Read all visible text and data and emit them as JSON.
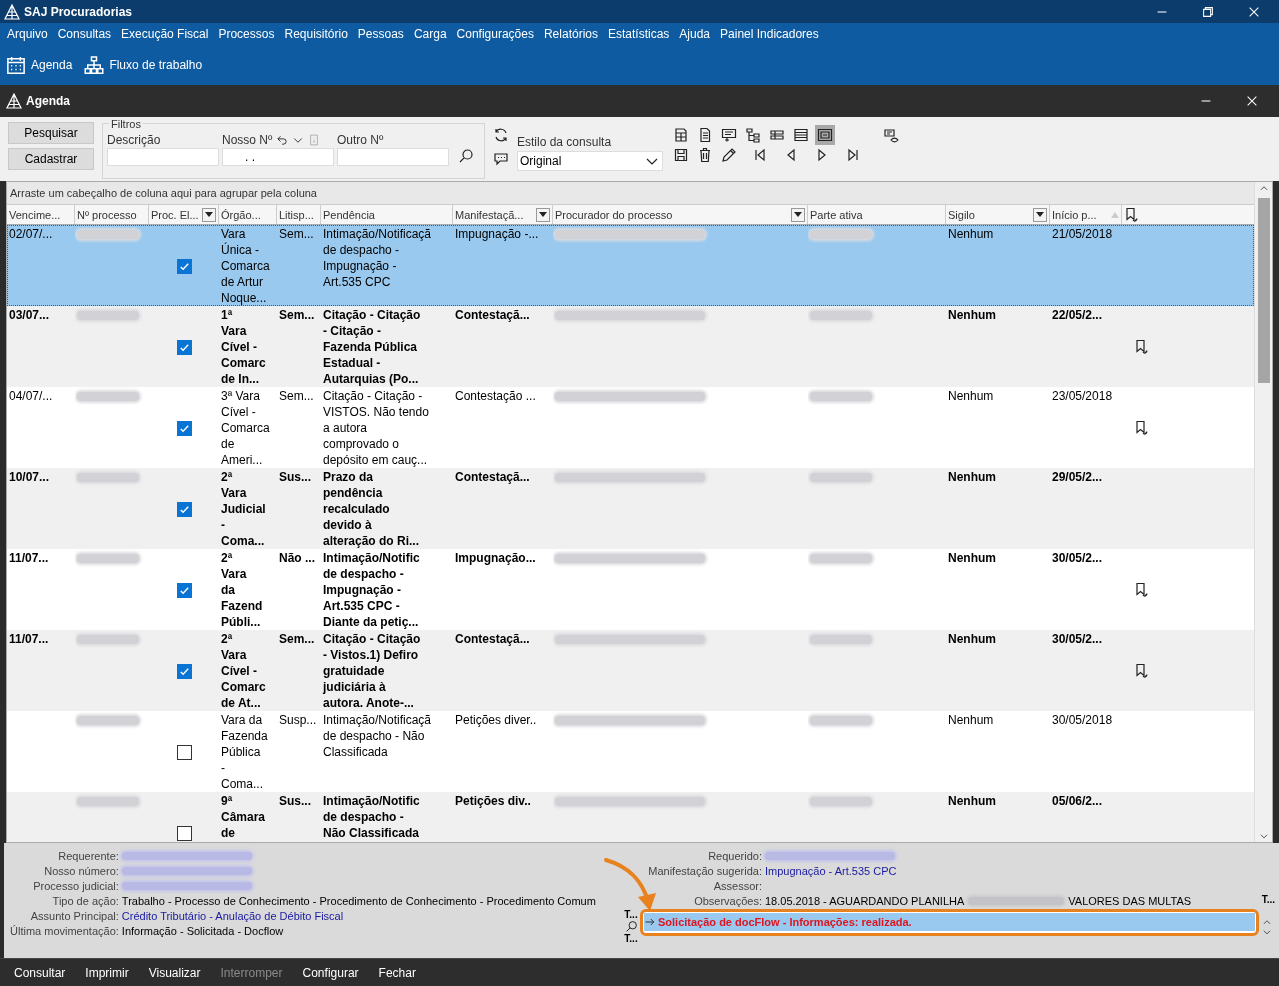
{
  "app": {
    "title": "SAJ Procuradorias"
  },
  "menu": [
    "Arquivo",
    "Consultas",
    "Execução Fiscal",
    "Processos",
    "Requisitório",
    "Pessoas",
    "Carga",
    "Configurações",
    "Relatórios",
    "Estatísticas",
    "Ajuda",
    "Painel Indicadores"
  ],
  "shortcuts": [
    {
      "label": "Agenda",
      "kind": "calendar"
    },
    {
      "label": "Fluxo de trabalho",
      "kind": "flowchart"
    }
  ],
  "window": {
    "title": "Agenda"
  },
  "actions": [
    "Pesquisar",
    "Cadastrar"
  ],
  "filters": {
    "title": "Filtros",
    "fields": [
      {
        "label": "Descrição",
        "kind": "text"
      },
      {
        "label": "Nosso Nº",
        "kind": "masked",
        "value": ". ."
      },
      {
        "label": "Outro Nº",
        "kind": "text"
      }
    ]
  },
  "query_style": {
    "label": "Estilo da consulta",
    "value": "Original"
  },
  "view_tools": [
    {
      "kind": "spreadsheet",
      "selected": false
    },
    {
      "kind": "document",
      "selected": false
    },
    {
      "kind": "form",
      "selected": false
    },
    {
      "kind": "tree",
      "selected": false
    },
    {
      "kind": "split",
      "selected": false
    },
    {
      "kind": "list",
      "selected": false
    },
    {
      "kind": "preview",
      "selected": true
    }
  ],
  "group_hint": "Arraste um cabeçalho de coluna aqui para agrupar pela coluna",
  "table": {
    "columns": [
      {
        "label": "Vencime...",
        "filter": false,
        "sorted": false
      },
      {
        "label": "Nº processo",
        "filter": false,
        "sorted": false
      },
      {
        "label": "Proc. El...",
        "filter": true,
        "sorted": false
      },
      {
        "label": "Órgão...",
        "filter": false,
        "sorted": false
      },
      {
        "label": "Litisp...",
        "filter": false,
        "sorted": false
      },
      {
        "label": "Pendência",
        "filter": false,
        "sorted": false
      },
      {
        "label": "Manifestaçã...",
        "filter": true,
        "sorted": false
      },
      {
        "label": "Procurador do processo",
        "filter": true,
        "sorted": false
      },
      {
        "label": "Parte ativa",
        "filter": false,
        "sorted": false
      },
      {
        "label": "Sigilo",
        "filter": true,
        "sorted": false
      },
      {
        "label": "Início p...",
        "filter": false,
        "sorted": true
      }
    ],
    "rows": [
      {
        "selected": true,
        "bold": false,
        "due": "02/07/...",
        "checked": true,
        "organ": "Vara\nÚnica -\nComarca\nde Artur\nNoque...",
        "litisp": "Sem...",
        "pending": "Intimação/Notificaçã\nde despacho -\nImpugnação -\nArt.535 CPC",
        "manifest": "Impugnação -...",
        "secrecy": "Nenhum",
        "start": "21/05/2018",
        "flagged": false
      },
      {
        "selected": false,
        "bold": true,
        "due": "03/07...",
        "checked": true,
        "organ": "1ª\nVara\nCível -\nComarc\nde In...",
        "litisp": "Sem...",
        "pending": "Citação - Citação\n- Citação -\nFazenda Pública\nEstadual -\nAutarquias (Po...",
        "manifest": "Contestaçã...",
        "secrecy": "Nenhum",
        "start": "22/05/2...",
        "flagged": true
      },
      {
        "selected": false,
        "bold": false,
        "due": "04/07/...",
        "checked": true,
        "organ": "3ª Vara\nCível -\nComarca\nde\nAmeri...",
        "litisp": "Sem...",
        "pending": "Citação - Citação -\nVISTOS. Não tendo\na autora\ncomprovado o\ndepósito em cauç...",
        "manifest": "Contestação ...",
        "secrecy": "Nenhum",
        "start": "23/05/2018",
        "flagged": true
      },
      {
        "selected": false,
        "bold": true,
        "due": "10/07...",
        "checked": true,
        "organ": "2ª\nVara\nJudicial\n-\nComa...",
        "litisp": "Sus...",
        "pending": "Prazo da\npendência\nrecalculado\ndevido à\nalteração do Ri...",
        "manifest": "Contestaçã...",
        "secrecy": "Nenhum",
        "start": "29/05/2...",
        "flagged": false
      },
      {
        "selected": false,
        "bold": true,
        "due": "11/07...",
        "checked": true,
        "organ": "2ª\nVara\nda\nFazend\nPúbli...",
        "litisp": "Não ...",
        "pending": "Intimação/Notific\nde despacho -\nImpugnação -\nArt.535 CPC -\nDiante da petiç...",
        "manifest": "Impugnação...",
        "secrecy": "Nenhum",
        "start": "30/05/2...",
        "flagged": true
      },
      {
        "selected": false,
        "bold": true,
        "due": "11/07...",
        "checked": true,
        "organ": "2ª\nVara\nCível -\nComarc\nde At...",
        "litisp": "Sem...",
        "pending": "Citação - Citação\n- Vistos.1) Defiro\ngratuidade\njudiciária à\nautora. Anote-...",
        "manifest": "Contestaçã...",
        "secrecy": "Nenhum",
        "start": "30/05/2...",
        "flagged": true
      },
      {
        "selected": false,
        "bold": false,
        "checked": false,
        "organ": "Vara da\nFazenda\nPública\n-\nComa...",
        "litisp": "Susp...",
        "pending": "Intimação/Notificaçã\nde despacho - Não\nClassificada",
        "manifest": "Petições diver..",
        "secrecy": "Nenhum",
        "start": "30/05/2018",
        "flagged": false
      },
      {
        "selected": false,
        "bold": true,
        "checked": false,
        "organ": "9ª\nCâmara\nde",
        "litisp": "Sus...",
        "pending": "Intimação/Notific\nde despacho -\nNão Classificada",
        "manifest": "Petições div..",
        "secrecy": "Nenhum",
        "start": "05/06/2...",
        "flagged": false
      }
    ]
  },
  "details_left": [
    {
      "label": "Requerente:",
      "kind": "redacted"
    },
    {
      "label": "Nosso número:",
      "kind": "redacted"
    },
    {
      "label": "Processo judicial:",
      "kind": "redacted"
    },
    {
      "label": "Tipo de ação:",
      "kind": "text",
      "value": "Trabalho - Processo de Conhecimento - Procedimento de Conhecimento - Procedimento Comum"
    },
    {
      "label": "Assunto Principal:",
      "kind": "link",
      "value": "Crédito Tributário - Anulação de Débito Fiscal"
    },
    {
      "label": "Última movimentação:",
      "kind": "text",
      "value": "Informação - Solicitada - Docflow"
    }
  ],
  "details_right": [
    {
      "label": "Requerido:",
      "kind": "redacted"
    },
    {
      "label": "Manifestação sugerida:",
      "kind": "link",
      "value": "Impugnação - Art.535 CPC"
    },
    {
      "label": "Assessor:",
      "kind": "empty"
    },
    {
      "label": "Observações:",
      "kind": "partly_redacted",
      "value": "18.05.2018 - AGUARDANDO PLANILHA",
      "value_after": "VALORES DAS MULTAS"
    }
  ],
  "log_panel": {
    "label_right": "T...",
    "labels_left": [
      "T...",
      "T..."
    ],
    "entries": [
      {
        "text": "Solicitação de docFlow - Informações: realizada.",
        "color": "#e0141e",
        "selected": true
      }
    ]
  },
  "footer": [
    {
      "label": "Consultar",
      "disabled": false
    },
    {
      "label": "Imprimir",
      "disabled": false
    },
    {
      "label": "Visualizar",
      "disabled": false
    },
    {
      "label": "Interromper",
      "disabled": true
    },
    {
      "label": "Configurar",
      "disabled": false
    },
    {
      "label": "Fechar",
      "disabled": false
    }
  ]
}
